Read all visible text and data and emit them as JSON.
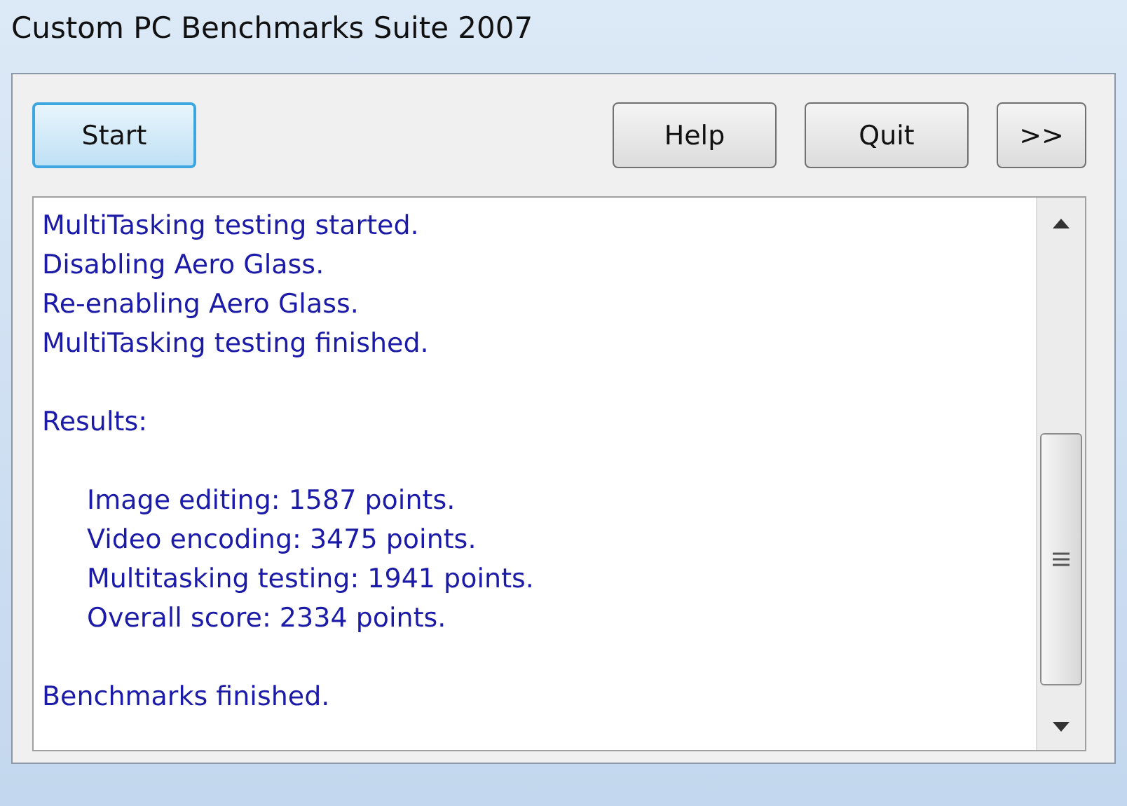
{
  "window": {
    "title": "Custom PC Benchmarks Suite 2007"
  },
  "buttons": [
    {
      "label": "Start",
      "default": true
    },
    {
      "label": "Help",
      "default": false
    },
    {
      "label": "Quit",
      "default": false
    },
    {
      "label": ">>",
      "default": false
    }
  ],
  "log": [
    {
      "indented": false,
      "lines": [
        "MultiTasking testing started.",
        "Disabling Aero Glass.",
        "Re-enabling Aero Glass.",
        "MultiTasking testing finished."
      ]
    },
    {
      "indented": false,
      "lines": [
        "Results:"
      ]
    },
    {
      "indented": true,
      "lines": [
        "Image editing: 1587 points.",
        "Video encoding: 3475 points.",
        "Multitasking testing: 1941 points.",
        "Overall score: 2334 points."
      ]
    },
    {
      "indented": false,
      "lines": [
        "Benchmarks finished."
      ]
    }
  ]
}
